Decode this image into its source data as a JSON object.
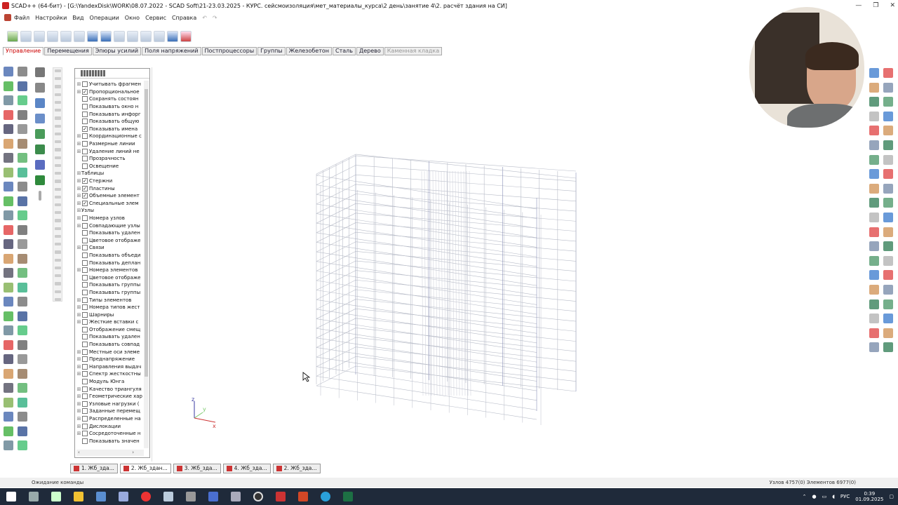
{
  "window": {
    "title": "SCAD++ (64-бит) - [G:\\YandexDisk\\WORK\\08.07.2022 - SCAD Soft\\21-23.03.2025 - КУРС. сейсмоизоляция\\мет_материалы_курса\\2 день\\занятие 4\\2. расчёт здания на СИ]",
    "controls": [
      "—",
      "❐",
      "✕"
    ]
  },
  "menu": [
    "Файл",
    "Настройки",
    "Вид",
    "Операции",
    "Окно",
    "Сервис",
    "Справка"
  ],
  "tabs": [
    {
      "label": "Управление",
      "state": "active"
    },
    {
      "label": "Перемещения",
      "state": "normal"
    },
    {
      "label": "Эпюры усилий",
      "state": "normal"
    },
    {
      "label": "Поля напряжений",
      "state": "normal"
    },
    {
      "label": "Постпроцессоры",
      "state": "normal"
    },
    {
      "label": "Группы",
      "state": "normal"
    },
    {
      "label": "Железобетон",
      "state": "normal"
    },
    {
      "label": "Сталь",
      "state": "normal"
    },
    {
      "label": "Дерево",
      "state": "normal"
    },
    {
      "label": "Каменная кладка",
      "state": "disabled"
    }
  ],
  "tree": [
    {
      "label": "Учитывать фрагмен",
      "checked": false,
      "exp": true
    },
    {
      "label": "Пропорциональное",
      "checked": true,
      "exp": true
    },
    {
      "label": "Сохранять состоян",
      "checked": false,
      "exp": false
    },
    {
      "label": "Показывать окно н",
      "checked": false,
      "exp": false
    },
    {
      "label": "Показывать инфорг",
      "checked": false,
      "exp": false
    },
    {
      "label": "Показывать общую",
      "checked": false,
      "exp": false
    },
    {
      "label": "Показывать имена",
      "checked": true,
      "exp": false
    },
    {
      "label": "Координационные с",
      "checked": false,
      "exp": true
    },
    {
      "label": "Размерные линии",
      "checked": false,
      "exp": true
    },
    {
      "label": "Удаление линий не",
      "checked": false,
      "exp": true
    },
    {
      "label": "Прозрачность",
      "checked": false,
      "exp": false
    },
    {
      "label": "Освещение",
      "checked": false,
      "exp": false
    },
    {
      "label": "Таблицы",
      "checked": null,
      "exp": true
    },
    {
      "label": "Стержни",
      "checked": true,
      "exp": true
    },
    {
      "label": "Пластины",
      "checked": true,
      "exp": true
    },
    {
      "label": "Объемные элемент",
      "checked": true,
      "exp": true
    },
    {
      "label": "Специальные элем",
      "checked": true,
      "exp": true
    },
    {
      "label": "Узлы",
      "checked": null,
      "exp": true
    },
    {
      "label": "Номера узлов",
      "checked": false,
      "exp": true
    },
    {
      "label": "Совпадающие узлы",
      "checked": false,
      "exp": true
    },
    {
      "label": "Показывать удален",
      "checked": false,
      "exp": false
    },
    {
      "label": "Цветовое отображе",
      "checked": false,
      "exp": false
    },
    {
      "label": "Связи",
      "checked": false,
      "exp": true
    },
    {
      "label": "Показывать объеди",
      "checked": false,
      "exp": false
    },
    {
      "label": "Показывать деплан",
      "checked": false,
      "exp": false
    },
    {
      "label": "Номера элементов",
      "checked": false,
      "exp": true
    },
    {
      "label": "Цветовое отображе",
      "checked": false,
      "exp": false
    },
    {
      "label": "Показывать группы",
      "checked": false,
      "exp": false
    },
    {
      "label": "Показывать группы",
      "checked": false,
      "exp": false
    },
    {
      "label": "Типы элементов",
      "checked": false,
      "exp": true
    },
    {
      "label": "Номера типов жест",
      "checked": false,
      "exp": true
    },
    {
      "label": "Шарниры",
      "checked": false,
      "exp": true
    },
    {
      "label": "Жесткие вставки с",
      "checked": false,
      "exp": true
    },
    {
      "label": "Отображение смещ",
      "checked": false,
      "exp": false
    },
    {
      "label": "Показывать удален",
      "checked": false,
      "exp": false
    },
    {
      "label": "Показывать совпад",
      "checked": false,
      "exp": false
    },
    {
      "label": "Местные оси элеме",
      "checked": false,
      "exp": true
    },
    {
      "label": "Преднапряжение",
      "checked": false,
      "exp": true
    },
    {
      "label": "Направления выдач",
      "checked": false,
      "exp": true
    },
    {
      "label": "Спектр жесткостны",
      "checked": false,
      "exp": true
    },
    {
      "label": "Модуль Юнга",
      "checked": false,
      "exp": false
    },
    {
      "label": "Качество триангуля",
      "checked": false,
      "exp": true
    },
    {
      "label": "Геометрические хар",
      "checked": false,
      "exp": true
    },
    {
      "label": "Узловые нагрузки (",
      "checked": false,
      "exp": true
    },
    {
      "label": "Заданные перемещ",
      "checked": false,
      "exp": true
    },
    {
      "label": "Распределенные на",
      "checked": false,
      "exp": true
    },
    {
      "label": "Дислокации",
      "checked": false,
      "exp": true
    },
    {
      "label": "Сосредоточенные н",
      "checked": false,
      "exp": true
    },
    {
      "label": "Показывать значен",
      "checked": false,
      "exp": false
    }
  ],
  "viewport": {
    "axes": {
      "z": "z",
      "y": "y",
      "x": "x"
    }
  },
  "bottom_tabs": [
    {
      "label": "1. Жб_зда...",
      "active": false
    },
    {
      "label": "2. Жб_здан...",
      "active": true
    },
    {
      "label": "3. Жб_зда...",
      "active": false
    },
    {
      "label": "4. Жб_зда...",
      "active": false
    },
    {
      "label": "2. Жб_зда...",
      "active": false
    }
  ],
  "status": {
    "left": "Ожидание команды",
    "right": "Узлов 4757(0) Элементов 6977(0)"
  },
  "tray": {
    "lang": "РУС",
    "time": "0:39",
    "date": "01.09.2025"
  },
  "colors": {
    "active_tab": "#c00000",
    "wire": "#b8bcc8",
    "wire_accent": "#8a8fb8"
  }
}
